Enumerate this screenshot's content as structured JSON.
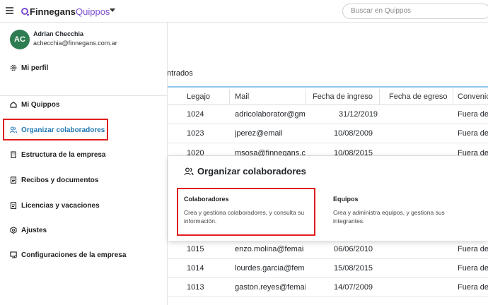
{
  "topbar": {
    "logo_primary": "Finnegans",
    "logo_secondary": "Quippos",
    "search_placeholder": "Buscar en Quippos"
  },
  "background": {
    "filter_tab": "ntrados",
    "table": {
      "columns": [
        "Legajo",
        "Mail",
        "Fecha de ingreso",
        "Fecha de egreso",
        "Convenio"
      ],
      "rows_top": [
        {
          "legajo": "1024",
          "mail": "adricolaborator@gm",
          "ingreso": "31/12/2019",
          "convenio": "Fuera de"
        },
        {
          "legajo": "1023",
          "mail": "jperez@email",
          "ingreso": "10/08/2009",
          "convenio": "Fuera de"
        },
        {
          "legajo": "1020",
          "mail": "msosa@finnegans.c",
          "ingreso": "10/08/2015",
          "convenio": "Fuera de"
        }
      ],
      "rows_bottom": [
        {
          "legajo": "1015",
          "mail": "enzo.molina@femai",
          "ingreso": "06/06/2010",
          "convenio": "Fuera de"
        },
        {
          "legajo": "1014",
          "mail": "lourdes.garcia@fem",
          "ingreso": "15/08/2015",
          "convenio": "Fuera de"
        },
        {
          "legajo": "1013",
          "mail": "gaston.reyes@femai",
          "ingreso": "14/07/2009",
          "convenio": "Fuera de"
        }
      ]
    }
  },
  "sidebar": {
    "user": {
      "initials": "AC",
      "name": "Adrian Checchia",
      "email": "achecchia@finnegans.com.ar"
    },
    "profile_label": "Mi perfil",
    "items": [
      {
        "label": "Mi Quippos",
        "icon": "home-icon"
      },
      {
        "label": "Organizar colaboradores",
        "icon": "users-icon"
      },
      {
        "label": "Estructura de la empresa",
        "icon": "building-icon"
      },
      {
        "label": "Recibos y documentos",
        "icon": "document-icon"
      },
      {
        "label": "Licencias y vacaciones",
        "icon": "calendar-icon"
      },
      {
        "label": "Ajustes",
        "icon": "gear-icon"
      },
      {
        "label": "Configuraciones de la empresa",
        "icon": "settings-screen-icon"
      }
    ]
  },
  "popup": {
    "title": "Organizar colaboradores",
    "cards": [
      {
        "title": "Colaboradores",
        "desc_line1": "Crea y gestiona colaboradores, y consulta su",
        "desc_line2": "información."
      },
      {
        "title": "Equipos",
        "desc_line1": "Crea y administra equipos, y gestiona sus",
        "desc_line2": "integrantes."
      }
    ]
  },
  "colors": {
    "accent": "#1d78b5",
    "highlight": "#e01e1e",
    "avatar": "#2e7d52",
    "brand": "#7a4fd0"
  }
}
